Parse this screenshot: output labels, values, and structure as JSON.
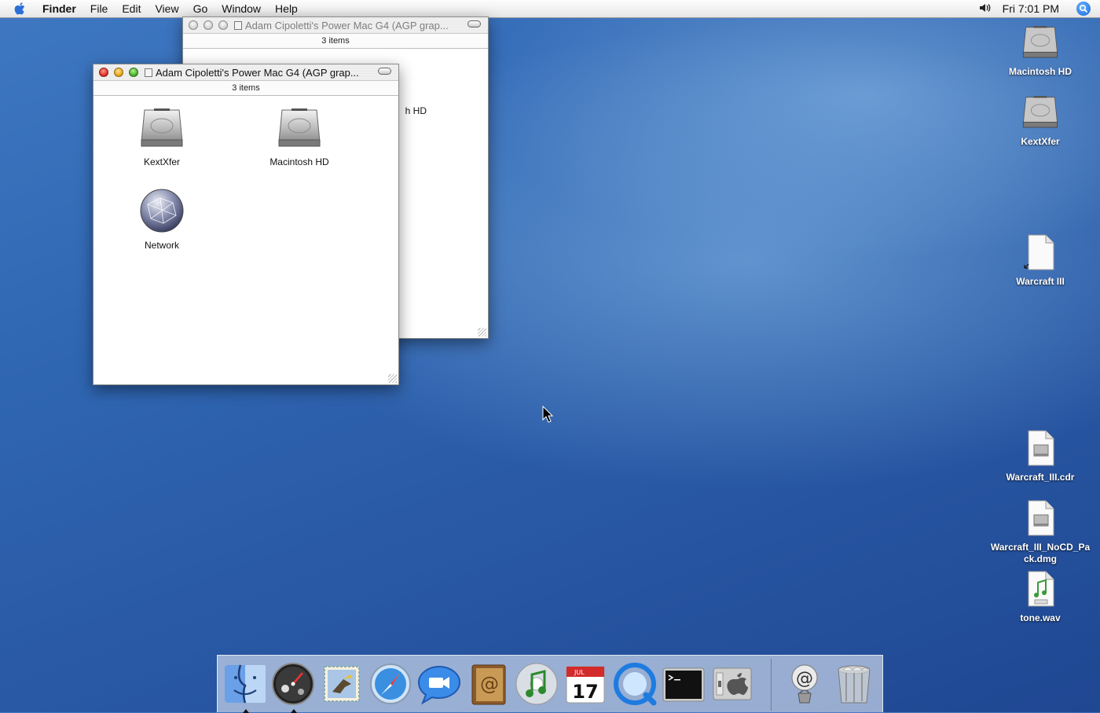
{
  "menubar": {
    "app_name": "Finder",
    "menus": [
      "File",
      "Edit",
      "View",
      "Go",
      "Window",
      "Help"
    ],
    "clock": "Fri 7:01 PM",
    "icons": [
      "apple-icon",
      "volume-icon",
      "spotlight-icon"
    ]
  },
  "windows": [
    {
      "title": "Adam Cipoletti's Power Mac G4 (AGP grap...",
      "status": "3 items",
      "active": false,
      "visible_label": "h HD"
    },
    {
      "title": "Adam Cipoletti's Power Mac G4 (AGP grap...",
      "status": "3 items",
      "active": true,
      "items": [
        {
          "label": "KextXfer",
          "icon": "hard-drive-icon"
        },
        {
          "label": "Macintosh HD",
          "icon": "hard-drive-icon"
        },
        {
          "label": "Network",
          "icon": "network-globe-icon"
        }
      ]
    }
  ],
  "desktop": {
    "items": [
      {
        "label": "Macintosh HD",
        "icon": "hard-drive-icon"
      },
      {
        "label": "KextXfer",
        "icon": "hard-drive-icon"
      },
      {
        "label": "Warcraft III",
        "icon": "alias-document-icon"
      },
      {
        "label": "Warcraft_III.cdr",
        "icon": "disk-image-icon"
      },
      {
        "label": "Warcraft_III_NoCD_Pack.dmg",
        "label_line1": "Warcraft_III_NoCD_Pa",
        "label_line2": "ck.dmg",
        "icon": "disk-image-icon"
      },
      {
        "label": "tone.wav",
        "icon": "audio-file-icon"
      }
    ]
  },
  "dock": {
    "items": [
      "finder-icon",
      "dashboard-icon",
      "mail-icon",
      "safari-icon",
      "ichat-icon",
      "address-book-icon",
      "itunes-icon",
      "ical-icon",
      "quicktime-icon",
      "terminal-icon",
      "system-preferences-icon",
      "internet-location-icon",
      "trash-icon"
    ],
    "ical_month": "JUL",
    "ical_day": "17"
  },
  "colors": {
    "desktop_blue": "#2f66b2",
    "close_red": "#d9241c",
    "minimize_yellow": "#e0a00e",
    "zoom_green": "#3ea524"
  }
}
